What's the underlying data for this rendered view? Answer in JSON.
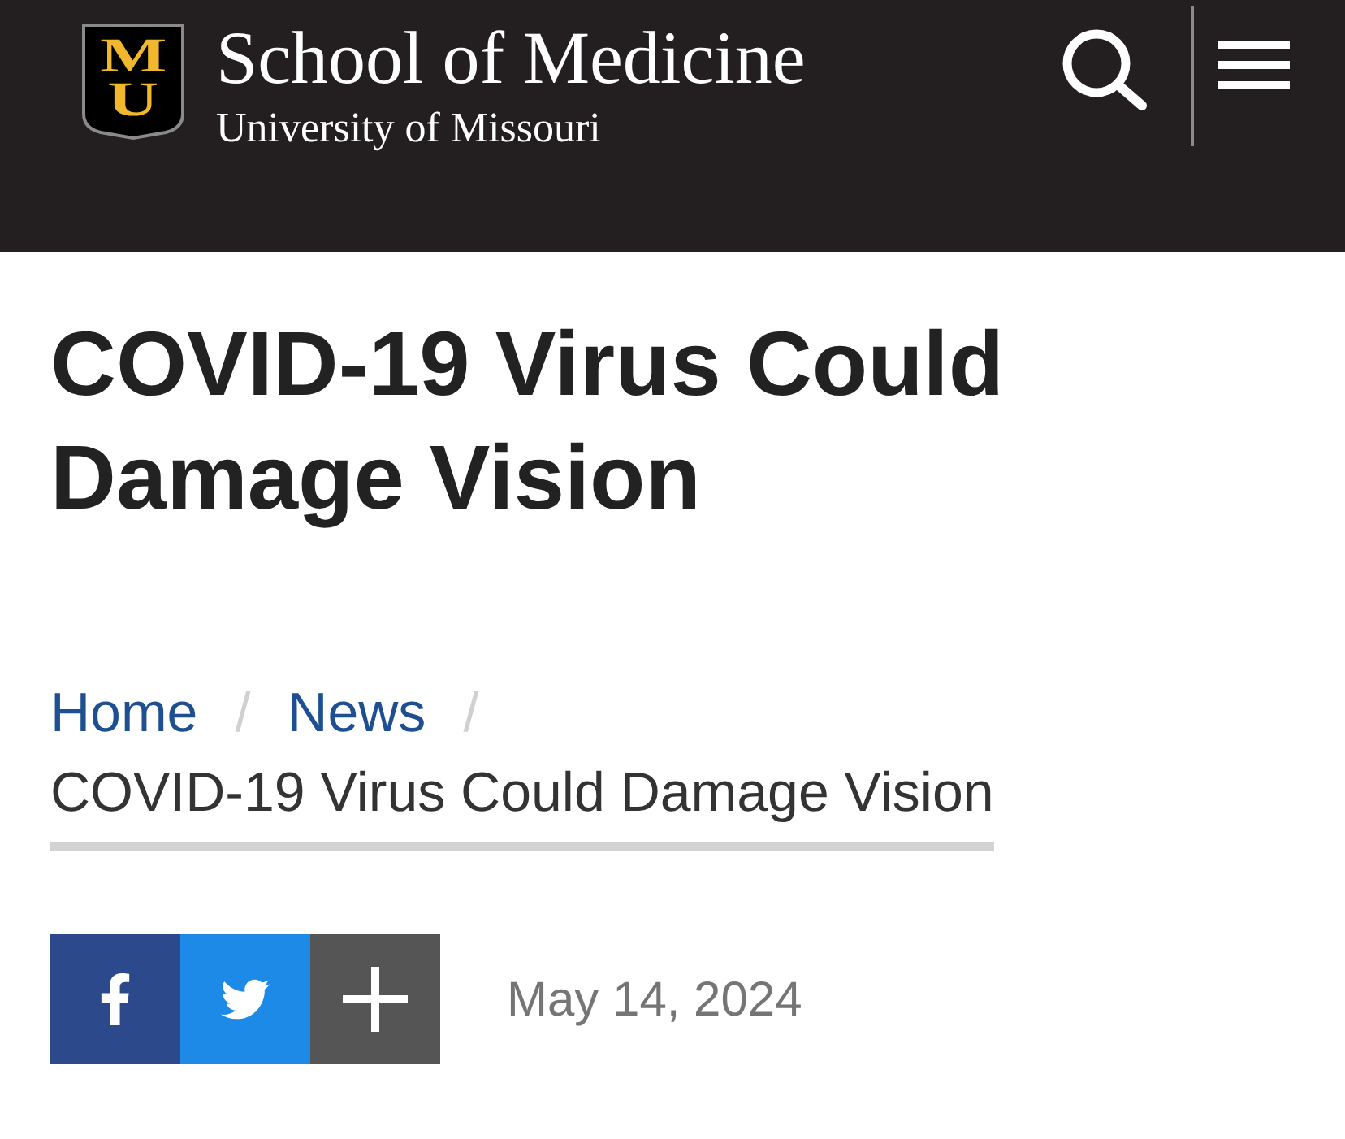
{
  "header": {
    "logo_letters": [
      "M",
      "U"
    ],
    "title": "School of Medicine",
    "subtitle": "University of Missouri"
  },
  "article": {
    "title": "COVID-19 Virus Could Damage Vision"
  },
  "breadcrumbs": [
    {
      "kind": "link",
      "label": "Home",
      "separator": "/"
    },
    {
      "kind": "link",
      "label": "News",
      "separator": "/"
    },
    {
      "kind": "current",
      "label": "COVID-19 Virus Could Damage Vision"
    }
  ],
  "share_buttons": [
    {
      "kind": "facebook"
    },
    {
      "kind": "twitter"
    },
    {
      "kind": "more"
    }
  ],
  "date": "May 14, 2024"
}
